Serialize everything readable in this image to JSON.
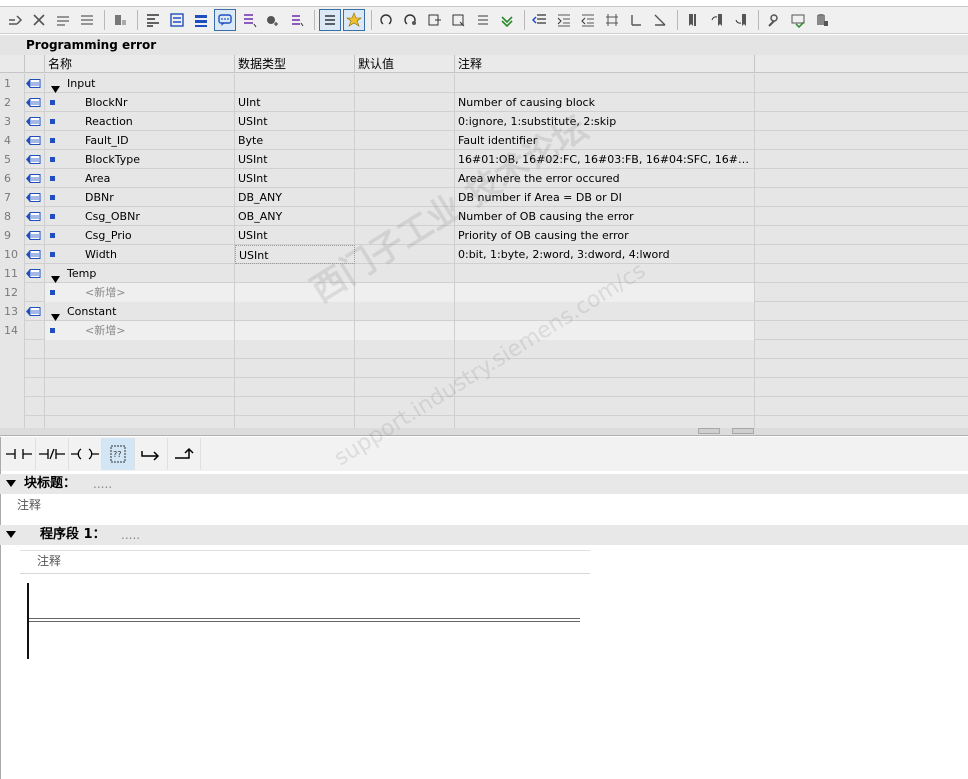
{
  "block": {
    "title": "Programming error"
  },
  "columns": {
    "name": "名称",
    "datatype": "数据类型",
    "default": "默认值",
    "comment": "注释"
  },
  "rows": [
    {
      "num": "1",
      "name": "Input",
      "type": "",
      "comment": "",
      "kind": "section"
    },
    {
      "num": "2",
      "name": "BlockNr",
      "type": "UInt",
      "comment": "Number of causing block",
      "kind": "var"
    },
    {
      "num": "3",
      "name": "Reaction",
      "type": "USInt",
      "comment": "0:ignore, 1:substitute, 2:skip",
      "kind": "var"
    },
    {
      "num": "4",
      "name": "Fault_ID",
      "type": "Byte",
      "comment": "Fault identifier",
      "kind": "var"
    },
    {
      "num": "5",
      "name": "BlockType",
      "type": "USInt",
      "comment": "16#01:OB, 16#02:FC, 16#03:FB, 16#04:SFC, 16#05...",
      "kind": "var"
    },
    {
      "num": "6",
      "name": "Area",
      "type": "USInt",
      "comment": "Area where the error occured",
      "kind": "var"
    },
    {
      "num": "7",
      "name": "DBNr",
      "type": "DB_ANY",
      "comment": "DB number if Area = DB or DI",
      "kind": "var"
    },
    {
      "num": "8",
      "name": "Csg_OBNr",
      "type": "OB_ANY",
      "comment": "Number of OB causing the error",
      "kind": "var"
    },
    {
      "num": "9",
      "name": "Csg_Prio",
      "type": "USInt",
      "comment": "Priority of OB causing the error",
      "kind": "var"
    },
    {
      "num": "10",
      "name": "Width",
      "type": "USInt",
      "comment": "0:bit, 1:byte, 2:word, 3:dword, 4:lword",
      "kind": "var"
    },
    {
      "num": "11",
      "name": "Temp",
      "type": "",
      "comment": "",
      "kind": "section"
    },
    {
      "num": "12",
      "name": "<新增>",
      "type": "",
      "comment": "",
      "kind": "new"
    },
    {
      "num": "13",
      "name": "Constant",
      "type": "",
      "comment": "",
      "kind": "section"
    },
    {
      "num": "14",
      "name": "<新增>",
      "type": "",
      "comment": "",
      "kind": "new"
    }
  ],
  "editor": {
    "block_title_label": "块标题：",
    "block_title_dots": ".....",
    "block_comment": "注释",
    "network_label": "程序段 1：",
    "network_dots": ".....",
    "network_comment": "注释"
  },
  "watermark": {
    "line1": "西门子工业  技术论坛",
    "line2": "support.industry.siemens.com/cs"
  },
  "colors": {
    "accent": "#1f4fbf",
    "toolbar_active": "#dbe9f7"
  }
}
